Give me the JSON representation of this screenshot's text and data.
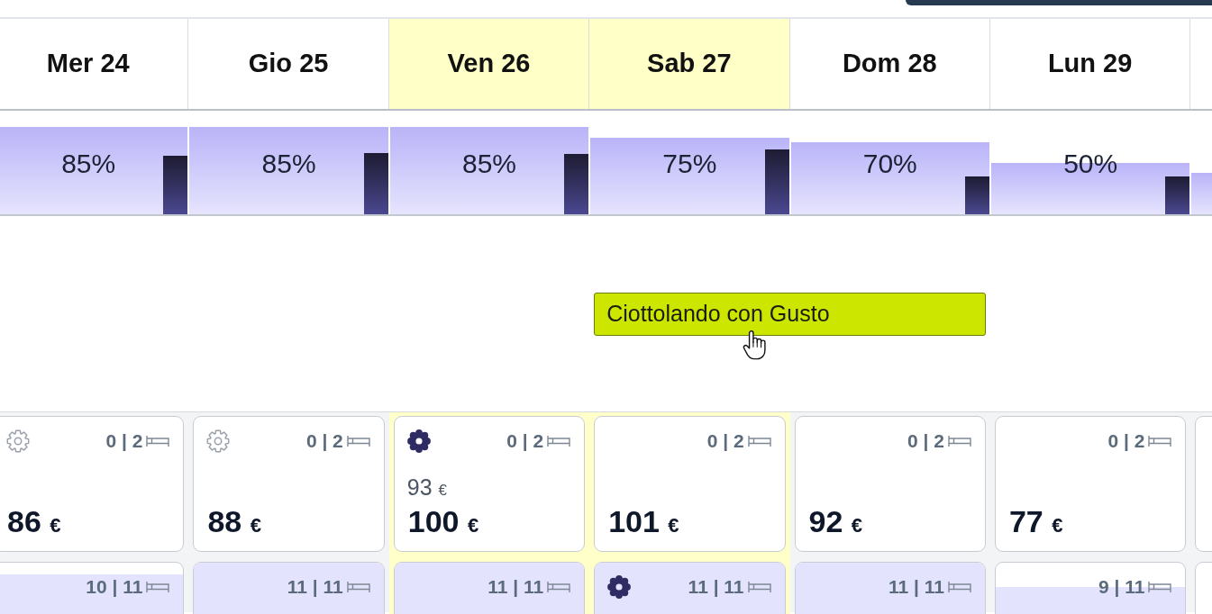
{
  "days": [
    {
      "label": "Mer 24",
      "highlighted": false,
      "occupancy": {
        "reading": "85%",
        "level": 0.85
      },
      "secondary_bar": {
        "level": 0.57
      },
      "rooms": [
        {
          "settings": {
            "active": false
          },
          "availability": "0 | 2",
          "price": {
            "amount": "86",
            "currency": "€"
          }
        },
        {
          "availability": "10 | 11",
          "level": 0.91
        }
      ]
    },
    {
      "label": "Gio 25",
      "highlighted": false,
      "occupancy": {
        "reading": "85%",
        "level": 0.85
      },
      "secondary_bar": {
        "level": 0.6
      },
      "rooms": [
        {
          "settings": {
            "active": false
          },
          "availability": "0 | 2",
          "price": {
            "amount": "88",
            "currency": "€"
          }
        },
        {
          "availability": "11 | 11",
          "level": 1
        }
      ]
    },
    {
      "label": "Ven 26",
      "highlighted": true,
      "occupancy": {
        "reading": "85%",
        "level": 0.85
      },
      "secondary_bar": {
        "level": 0.59
      },
      "rooms": [
        {
          "settings": {
            "active": true
          },
          "availability": "0 | 2",
          "previous_price": {
            "amount": "93",
            "currency": "€"
          },
          "price": {
            "amount": "100",
            "currency": "€"
          }
        },
        {
          "availability": "11 | 11",
          "level": 1
        }
      ]
    },
    {
      "label": "Sab 27",
      "highlighted": true,
      "occupancy": {
        "reading": "75%",
        "level": 0.75
      },
      "secondary_bar": {
        "level": 0.63
      },
      "events": [
        {
          "title": "Ciottolando con Gusto",
          "spans_next_day": true
        }
      ],
      "rooms": [
        {
          "availability": "0 | 2",
          "price": {
            "amount": "101",
            "currency": "€"
          }
        },
        {
          "settings": {
            "active": true
          },
          "availability": "11 | 11",
          "level": 1
        }
      ]
    },
    {
      "label": "Dom 28",
      "highlighted": false,
      "occupancy": {
        "reading": "70%",
        "level": 0.7
      },
      "secondary_bar": {
        "level": 0.37
      },
      "rooms": [
        {
          "availability": "0 | 2",
          "price": {
            "amount": "92",
            "currency": "€"
          }
        },
        {
          "availability": "11 | 11",
          "level": 1
        }
      ]
    },
    {
      "label": "Lun 29",
      "highlighted": false,
      "occupancy": {
        "reading": "50%",
        "level": 0.5
      },
      "secondary_bar": {
        "level": 0.37
      },
      "rooms": [
        {
          "availability": "0 | 2",
          "price": {
            "amount": "77",
            "currency": "€"
          }
        },
        {
          "availability": "9 | 11",
          "level": 0.82
        }
      ]
    },
    {
      "occupancy": {
        "level": 0.4
      }
    }
  ]
}
